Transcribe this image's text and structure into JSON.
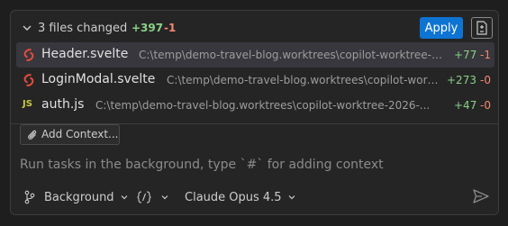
{
  "summary": {
    "title": "3 files changed",
    "additions": "+397",
    "deletions": "-1",
    "apply_label": "Apply"
  },
  "files": [
    {
      "name": "Header.svelte",
      "path": "C:\\temp\\demo-travel-blog.worktrees\\copilot-worktree-2026-...",
      "additions": "+77",
      "deletions": "-1",
      "icon": "svelte-icon"
    },
    {
      "name": "LoginModal.svelte",
      "path": "C:\\temp\\demo-travel-blog.worktrees\\copilot-worktree-2026-...",
      "additions": "+273",
      "deletions": "-0",
      "icon": "svelte-icon"
    },
    {
      "name": "auth.js",
      "path": "C:\\temp\\demo-travel-blog.worktrees\\copilot-worktree-2026-...",
      "additions": "+47",
      "deletions": "-0",
      "icon": "js-icon",
      "icon_text": "JS"
    }
  ],
  "input": {
    "add_context_label": "Add Context...",
    "placeholder": "Run tasks in the background, type `#` for adding context"
  },
  "toolbar": {
    "mode_label": "Background",
    "model_label": "Claude Opus 4.5"
  },
  "colors": {
    "accent": "#0e74d3",
    "additions": "#89d185",
    "deletions": "#f48771",
    "svelte": "#e44d3a",
    "js": "#cbcb41"
  }
}
